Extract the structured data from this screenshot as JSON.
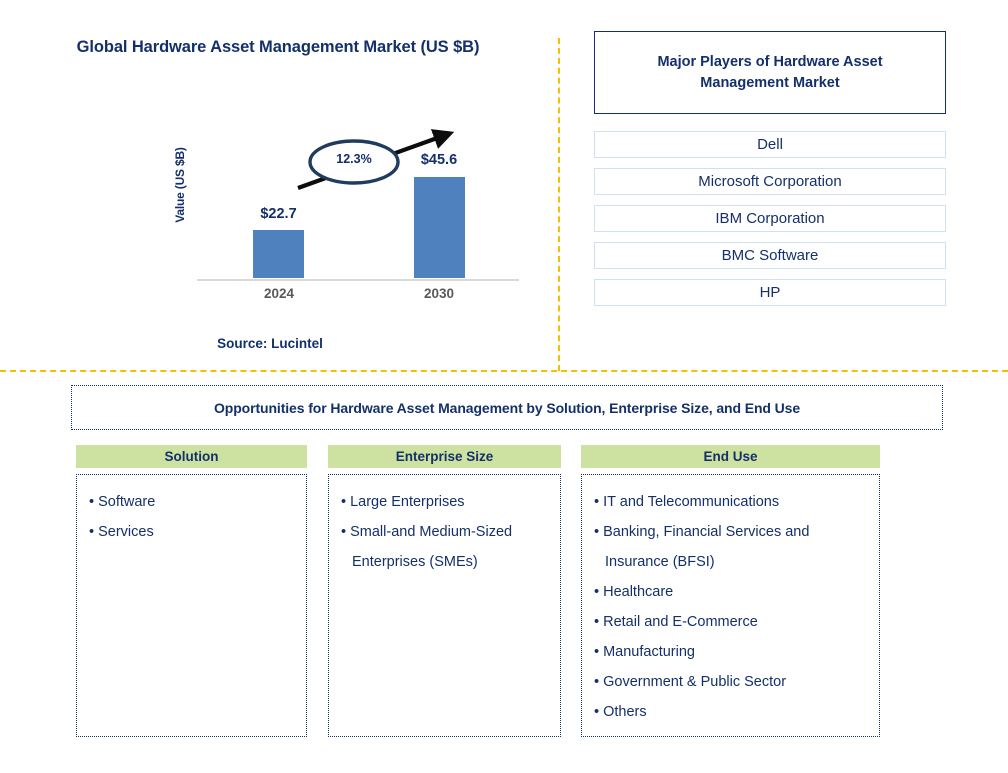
{
  "chart_panel": {
    "title": "Global Hardware Asset Management Market (US $B)",
    "y_axis_label": "Value (US $B)",
    "source": "Source: Lucintel"
  },
  "chart_data": {
    "type": "bar",
    "title": "Global Hardware Asset Management Market (US $B)",
    "xlabel": "",
    "ylabel": "Value (US $B)",
    "categories": [
      "2024",
      "2030"
    ],
    "values": [
      22.7,
      45.6
    ],
    "value_labels": [
      "$22.7",
      "$45.6"
    ],
    "ylim": [
      0,
      50
    ],
    "grid": false,
    "legend": false,
    "bar_color": "#4E81BD",
    "annotation": {
      "text": "12.3%",
      "meaning": "CAGR from 2024 to 2030",
      "shape": "ellipse-with-arrow"
    }
  },
  "players": {
    "header": "Major Players of Hardware Asset Management Market",
    "items": [
      {
        "label": "Dell"
      },
      {
        "label": "Microsoft Corporation"
      },
      {
        "label": "IBM Corporation"
      },
      {
        "label": "BMC Software"
      },
      {
        "label": "HP"
      }
    ]
  },
  "opportunities": {
    "banner": "Opportunities for Hardware Asset Management by Solution, Enterprise Size, and End Use",
    "columns": [
      {
        "header": "Solution",
        "items": [
          "Software",
          "Services"
        ]
      },
      {
        "header": "Enterprise Size",
        "items": [
          "Large Enterprises",
          "Small-and Medium-Sized Enterprises (SMEs)"
        ]
      },
      {
        "header": "End Use",
        "items": [
          "IT and Telecommunications",
          "Banking, Financial Services and Insurance (BFSI)",
          "Healthcare",
          "Retail and E-Commerce",
          "Manufacturing",
          "Government & Public Sector",
          "Others"
        ]
      }
    ]
  },
  "colors": {
    "navy": "#14306B",
    "bar_blue": "#4E81BD",
    "green_header": "#CDE2A0",
    "divider_gold": "#F2C200",
    "player_border": "#CFE0F0"
  }
}
